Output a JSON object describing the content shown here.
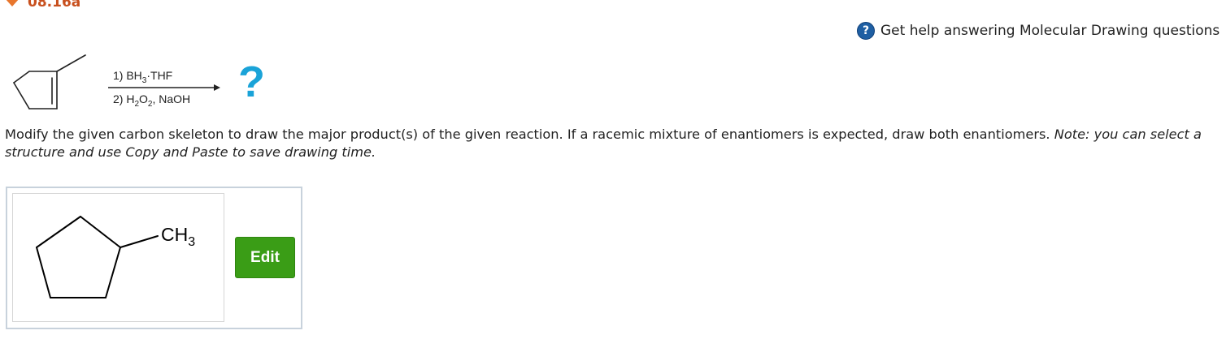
{
  "question_header": {
    "id": "08.16a"
  },
  "help_link": {
    "icon": "question-circle-icon",
    "text": "Get help answering Molecular Drawing questions"
  },
  "reaction": {
    "step1_prefix": "1) BH",
    "step1_sub": "3",
    "step1_suffix": "·THF",
    "step2_prefix": "2) H",
    "step2_sub1": "2",
    "step2_mid": "O",
    "step2_sub2": "2",
    "step2_suffix": ", NaOH",
    "unknown_product": "?"
  },
  "instructions": {
    "main_text": "Modify the given carbon skeleton to draw the major product(s) of the given reaction. If a racemic mixture of enantiomers is expected, draw both enantiomers.",
    "note_text": "Note: you can select a structure and use Copy and Paste to save drawing time."
  },
  "drawing": {
    "substituent_label_main": "CH",
    "substituent_label_sub": "3",
    "edit_button_label": "Edit"
  },
  "colors": {
    "header_orange": "#c8501e",
    "help_icon_blue": "#1f5fa3",
    "question_mark_cyan": "#1aa3d8",
    "edit_button_green": "#3a9d16"
  }
}
